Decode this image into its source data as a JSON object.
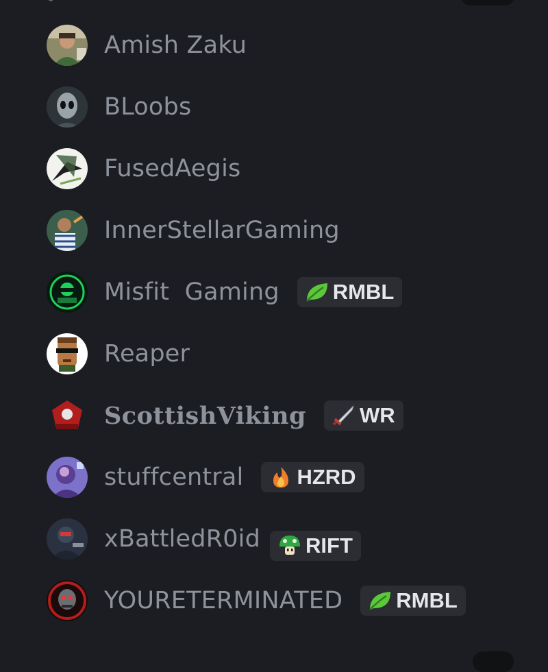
{
  "members": [
    {
      "name": "Amish Zaku",
      "avatar": "avatar-photo-icon"
    },
    {
      "name": "BLoobs",
      "avatar": "alien-avatar-icon"
    },
    {
      "name": "FusedAegis",
      "avatar": "abstract-avatar-icon"
    },
    {
      "name": "InnerStellarGaming",
      "avatar": "person-avatar-icon"
    },
    {
      "name": "Misfit  Gaming",
      "avatar": "green-gamer-avatar-icon",
      "tag": {
        "label": "RMBL",
        "icon": "leaf-icon"
      }
    },
    {
      "name": "Reaper",
      "avatar": "doom-face-avatar-icon"
    },
    {
      "name": "ScottishViking",
      "avatar": "red-logo-avatar-icon",
      "tag": {
        "label": "WR",
        "icon": "sword-icon"
      }
    },
    {
      "name": "stuffcentral",
      "avatar": "purple-avatar-icon",
      "tag": {
        "label": "HZRD",
        "icon": "fire-icon"
      }
    },
    {
      "name": "xBattledR0id",
      "avatar": "soldier-avatar-icon",
      "tag": {
        "label": "RIFT",
        "icon": "mushroom-icon"
      }
    },
    {
      "name": "YOURETERMINATED",
      "avatar": "terminator-avatar-icon",
      "tag": {
        "label": "RMBL",
        "icon": "leaf-icon"
      }
    }
  ]
}
